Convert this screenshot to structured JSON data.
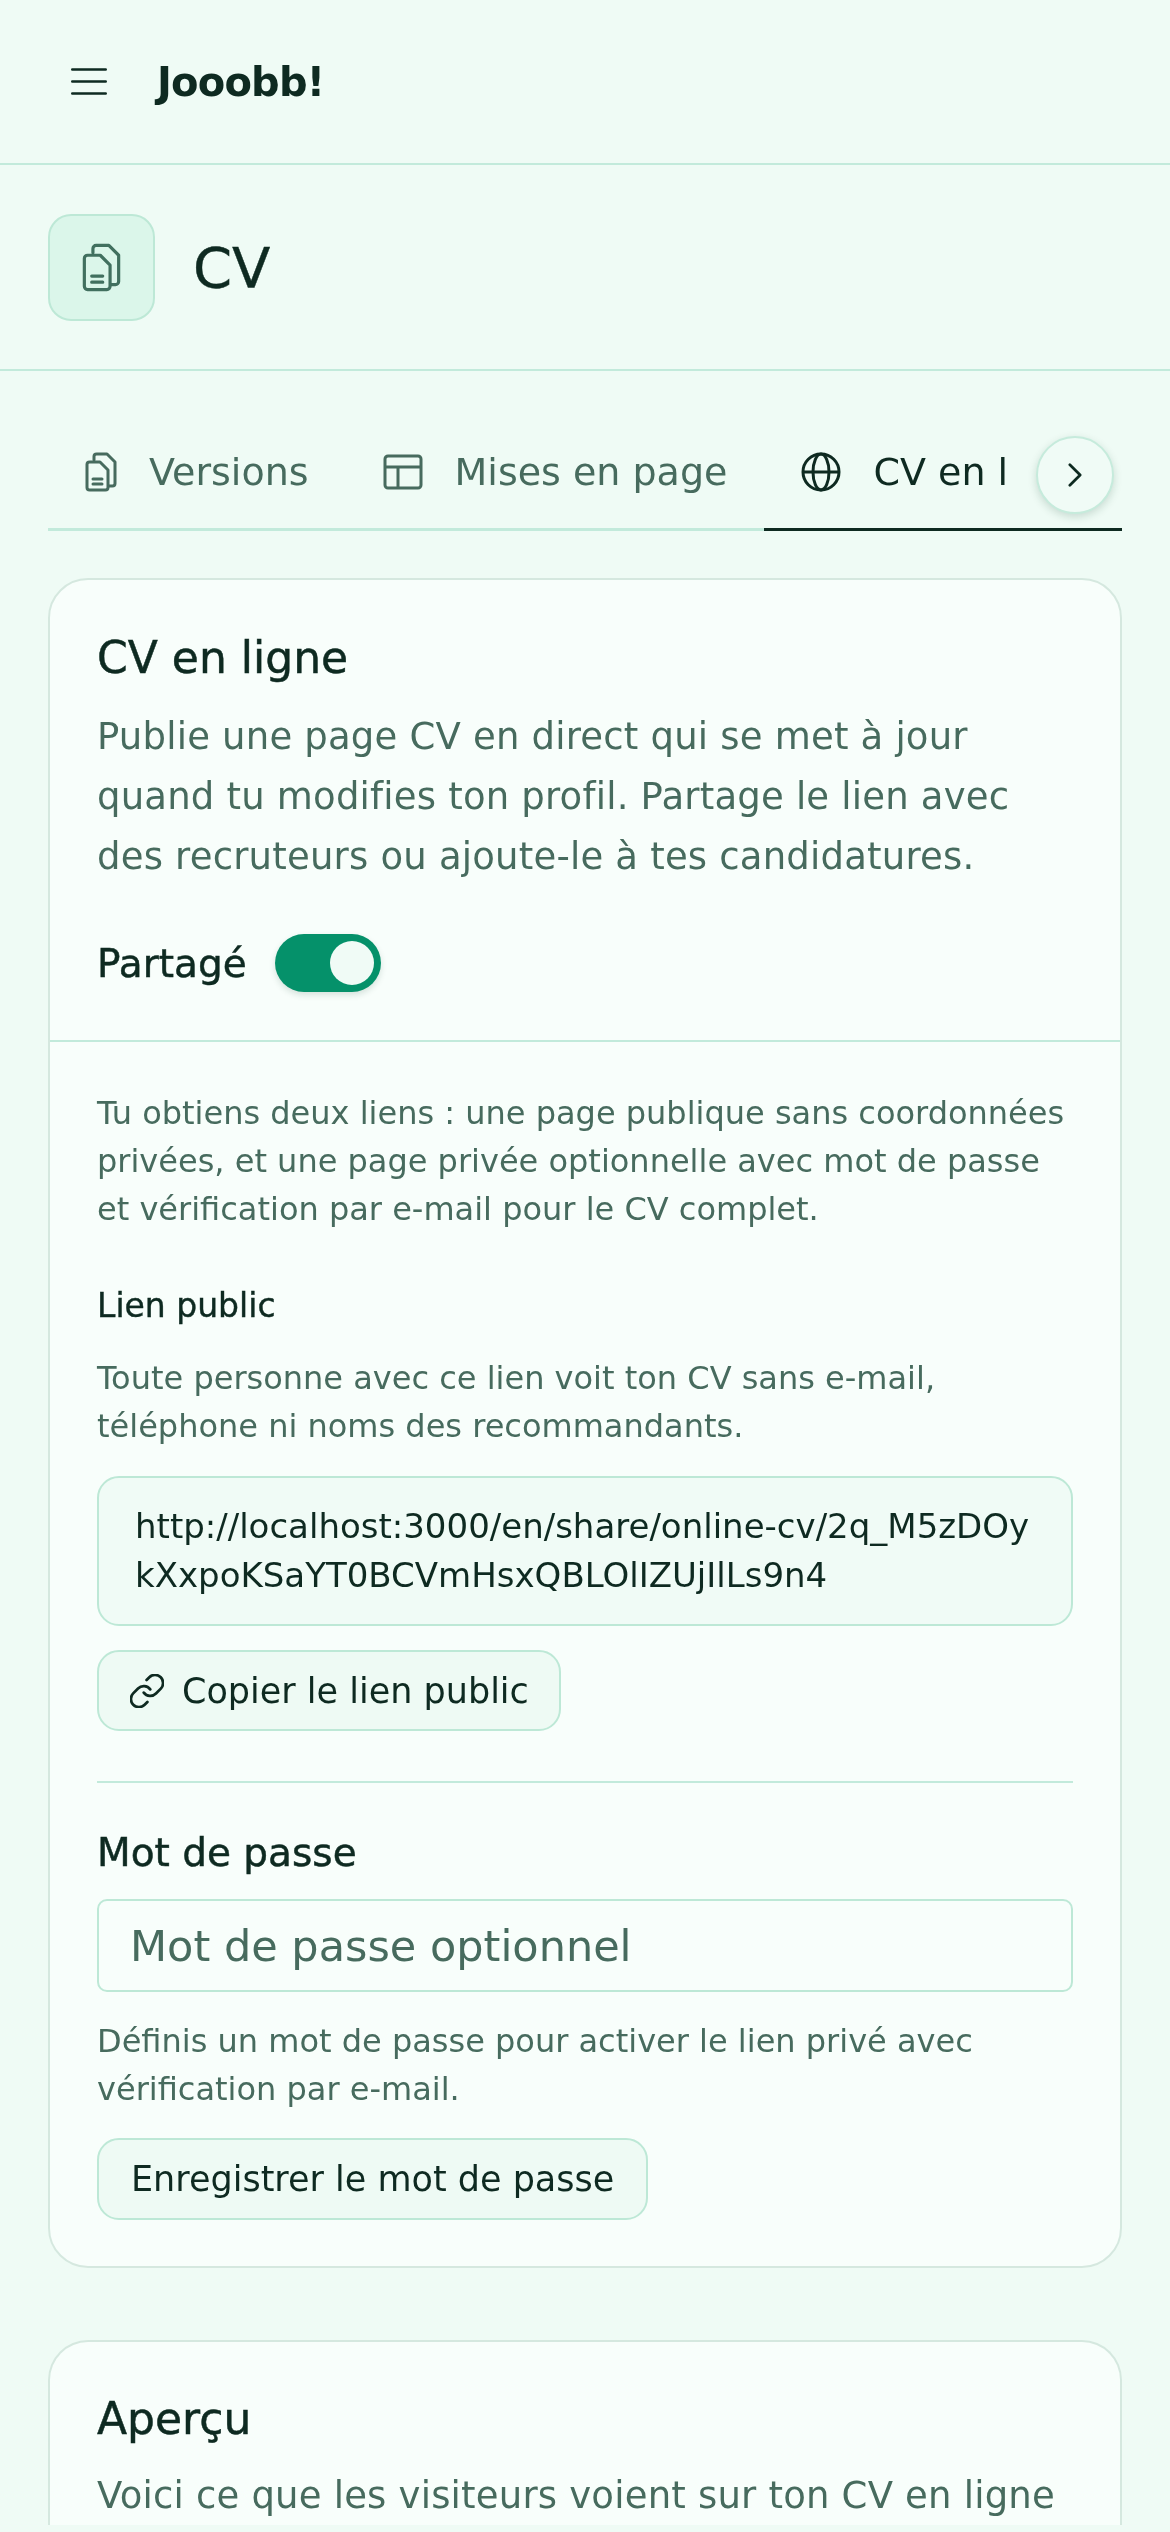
{
  "app_bar": {
    "brand": "Jooobb!"
  },
  "page_header": {
    "title": "CV"
  },
  "tabs": [
    {
      "label": "Versions",
      "selected": false
    },
    {
      "label": "Mises en page",
      "selected": false
    },
    {
      "label": "CV en l",
      "selected": true
    }
  ],
  "online_cv_card": {
    "title": "CV en ligne",
    "description": "Publie une page CV en direct qui se met à jour quand tu modifies ton profil. Partage le lien avec des recruteurs ou ajoute-le à tes candidatures.",
    "shared_toggle": {
      "label": "Partagé",
      "on": true
    },
    "intro": "Tu obtiens deux liens : une page publique sans coordonnées privées, et une page privée optionnelle avec mot de passe et vérification par e-mail pour le CV complet.",
    "public_link": {
      "heading": "Lien public",
      "description": "Toute personne avec ce lien voit ton CV sans e-mail, téléphone ni noms des recommandants.",
      "url": "http://localhost:3000/en/share/online-cv/2q_M5zDOykXxpoKSaYT0BCVmHsxQBLOlIZUjIlLs9n4",
      "copy_button": "Copier le lien public"
    },
    "password": {
      "label": "Mot de passe",
      "placeholder": "Mot de passe optionnel",
      "hint": "Définis un mot de passe pour activer le lien privé avec vérification par e-mail.",
      "save_button": "Enregistrer le mot de passe"
    }
  },
  "preview_card": {
    "title": "Aperçu",
    "description": "Voici ce que les visiteurs voient sur ton CV en ligne"
  }
}
